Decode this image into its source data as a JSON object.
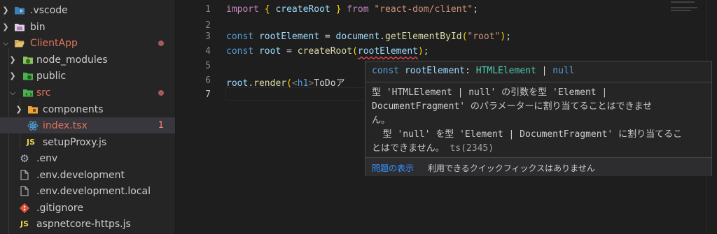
{
  "colors": {
    "accent_blue": "#3794ff",
    "error_red": "#f14c4c",
    "modified_dot": "#a35b5b"
  },
  "explorer": {
    "items": [
      {
        "label": ".vscode",
        "icon": "vscode-folder-icon",
        "chevron": "chevron-right-icon"
      },
      {
        "label": "bin",
        "icon": "folder-icon",
        "chevron": "chevron-right-icon"
      },
      {
        "label": "ClientApp",
        "icon": "folder-open-icon",
        "chevron": "chevron-down-icon",
        "modified": true
      },
      {
        "label": "node_modules",
        "icon": "node-folder-icon",
        "chevron": "chevron-right-icon"
      },
      {
        "label": "public",
        "icon": "public-folder-icon",
        "chevron": "chevron-right-icon"
      },
      {
        "label": "src",
        "icon": "src-folder-icon",
        "chevron": "chevron-down-icon",
        "modified": true
      },
      {
        "label": "components",
        "icon": "components-folder-icon",
        "chevron": "chevron-right-icon"
      },
      {
        "label": "index.tsx",
        "icon": "react-icon",
        "badge": "1"
      },
      {
        "label": "setupProxy.js",
        "icon": "js-icon",
        "icon_text": "JS"
      },
      {
        "label": ".env",
        "icon": "gear-icon"
      },
      {
        "label": ".env.development",
        "icon": "file-icon"
      },
      {
        "label": ".env.development.local",
        "icon": "file-icon"
      },
      {
        "label": ".gitignore",
        "icon": "git-icon"
      },
      {
        "label": "aspnetcore-https.js",
        "icon": "js-icon",
        "icon_text": "JS"
      }
    ]
  },
  "editor": {
    "line_numbers": [
      "1",
      "2",
      "3",
      "4",
      "5",
      "6",
      "7"
    ],
    "lines": {
      "l1": {
        "import": "import",
        "ob": "{",
        "name": "createRoot",
        "cb": "}",
        "from": "from",
        "str": "\"react-dom/client\"",
        "semi": ";"
      },
      "l3": {
        "const": "const",
        "var": "rootElement",
        "eq": " = ",
        "obj": "document",
        "dot": ".",
        "fn": "getElementById",
        "op": "(",
        "str": "\"root\"",
        "cp": ")",
        "semi": ";"
      },
      "l4": {
        "const": "const",
        "var": "root",
        "eq": " = ",
        "fn": "createRoot",
        "op": "(",
        "arg": "rootElement",
        "cp": ")",
        "semi": ";"
      },
      "l6": {
        "obj": "root",
        "dot": ".",
        "fn": "render",
        "op": "(",
        "lt": "<",
        "tag": "h1",
        "gt": ">",
        "text": "ToDoア"
      }
    }
  },
  "hover": {
    "signature": {
      "const": "const",
      "name": "rootElement",
      "colon": ": ",
      "type": "HTMLElement",
      "pipe": " | ",
      "null": "null"
    },
    "message": {
      "line1": "型 'HTMLElement | null' の引数を型 'Element |",
      "line2": "DocumentFragment' のパラメーターに割り当てることはできませ",
      "line3": "ん。",
      "line4": "  型 'null' を型 'Element | DocumentFragment' に割り当てるこ",
      "line5": "とはできません。",
      "code": "ts(2345)"
    },
    "actions": {
      "view_problem": "問題の表示",
      "no_quick_fix": "利用できるクイックフィックスはありません"
    }
  }
}
